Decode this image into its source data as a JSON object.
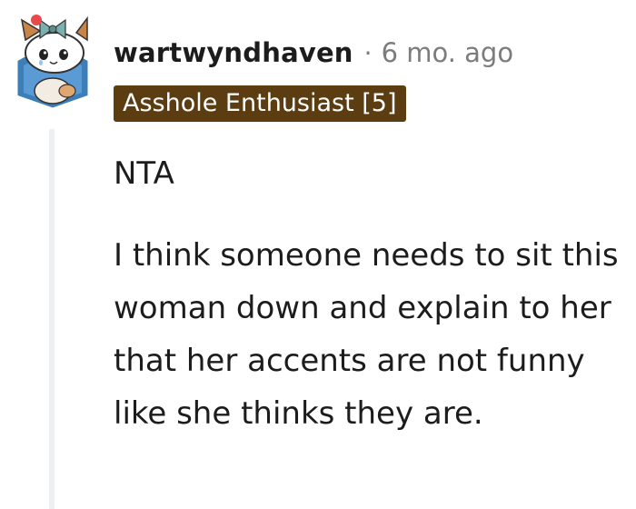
{
  "comment": {
    "author": "wartwyndhaven",
    "separator": "·",
    "timestamp": "6 mo. ago",
    "flair": "Asshole Enthusiast [5]",
    "paragraphs": [
      "NTA",
      "I think someone needs to sit this woman down and explain to her that her accents are not funny like she thinks they are."
    ]
  },
  "avatar": {
    "icon": "snoo-avatar-cat-bow-icon",
    "colors": {
      "hexagon": "#3d7eb8",
      "bow": "#7bb0b0",
      "bow_ball": "#e8494a",
      "ears": "#c9844a"
    }
  },
  "colors": {
    "flair_background": "#5c3d12",
    "flair_text": "#ffffff",
    "meta_text": "#7c7c7c",
    "thread_line": "#edeff1"
  }
}
